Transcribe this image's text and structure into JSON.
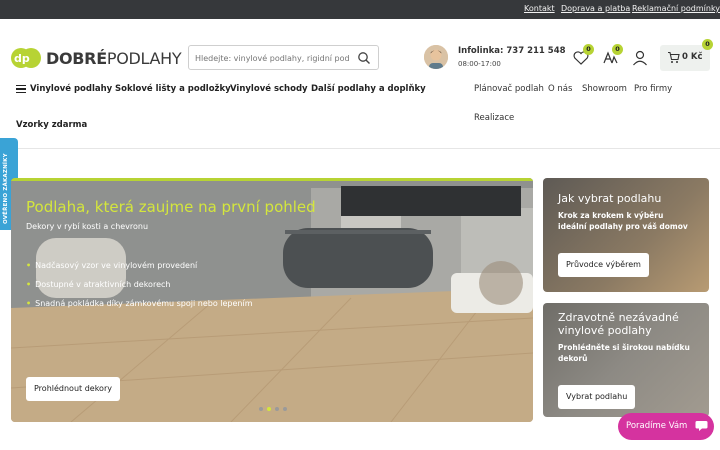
{
  "topbar": {
    "links": [
      "Kontakt",
      "Doprava a platba",
      "Reklamační podmínky"
    ]
  },
  "logo": {
    "bold": "DOBRÉ",
    "thin": "PODLAHY"
  },
  "search": {
    "placeholder": "Hledejte: vinylové podlahy, rigidní podlahy."
  },
  "contact": {
    "phone": "Infolinka: 737 211 548",
    "hours": "08:00-17:00"
  },
  "badges": {
    "wishlist": "0",
    "compare": "0",
    "cart": "0"
  },
  "cart": {
    "total": "0 Kč"
  },
  "nav": {
    "main": [
      "Vinylové podlahy",
      "Soklové lišty a podložky",
      "Vinylové schody",
      "Další podlahy a doplňky",
      "Vzorky zdarma"
    ],
    "secondary": [
      "Plánovač podlah",
      "O nás",
      "Showroom",
      "Pro firmy",
      "Realizace"
    ]
  },
  "side_tab": {
    "label": "OVĚŘENO ZÁKAZNÍKY"
  },
  "hero": {
    "title": "Podlaha, která zaujme na první pohled",
    "subtitle": "Dekory v rybí kosti a chevronu",
    "bullets": [
      "Nadčasový vzor ve vinylovém provedení",
      "Dostupné v atraktivních dekorech",
      "Snadná pokládka díky zámkovému spoji nebo lepením"
    ],
    "button": "Prohlédnout dekory",
    "slides": 4,
    "active_slide": 2
  },
  "cards": [
    {
      "title": "Jak vybrat podlahu",
      "desc_lines": [
        "Krok za krokem k výběru",
        "ideální podlahy pro váš domov"
      ],
      "button": "Průvodce výběrem"
    },
    {
      "title_lines": [
        "Zdravotně nezávadné",
        "vinylové podlahy"
      ],
      "desc_lines": [
        "Prohlédněte si širokou nabídku",
        "dekorů"
      ],
      "button": "Vybrat podlahu"
    }
  ],
  "chat": {
    "label": "Poradíme Vám"
  },
  "colors": {
    "accent": "#b7d334",
    "topbar": "#36383b",
    "chat": "#d5339f",
    "side_tab": "#3aa3d6"
  }
}
